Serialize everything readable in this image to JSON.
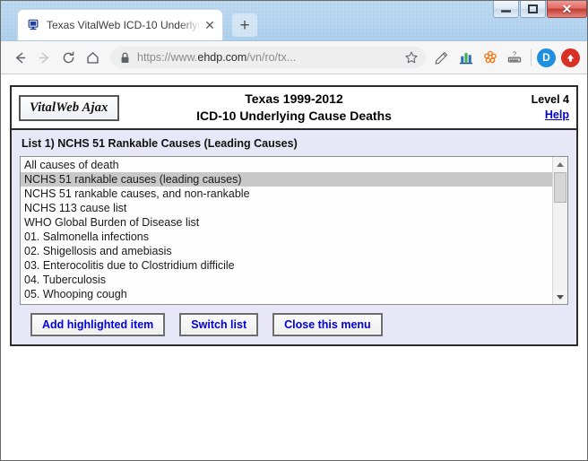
{
  "browser": {
    "tab": {
      "title": "Texas VitalWeb ICD-10 Underlyin",
      "favicon": "computer-monitor-icon",
      "close_label": "✕"
    },
    "new_tab_label": "+",
    "window_controls": {
      "minimize": "minimize-icon",
      "maximize": "maximize-icon",
      "close": "✕"
    },
    "nav": {
      "back": "back-arrow-icon",
      "forward": "forward-arrow-icon",
      "reload": "reload-icon",
      "home": "home-icon"
    },
    "omnibox": {
      "lock": "lock-icon",
      "scheme": "https://www.",
      "host": "ehdp.com",
      "path": "/vn/ro/tx...",
      "bookmark": "star-icon"
    },
    "extensions": [
      {
        "name": "note-pen-icon"
      },
      {
        "name": "bar-chart-icon"
      },
      {
        "name": "molecule-flower-icon"
      },
      {
        "name": "keyboard-help-icon"
      }
    ],
    "profile": {
      "initial": "D",
      "color": "#1f8fe0"
    },
    "update": {
      "name": "update-arrow-icon",
      "color": "#d93025"
    }
  },
  "page": {
    "brand_button": "VitalWeb Ajax",
    "title_line1": "Texas 1999-2012",
    "title_line2": "ICD-10 Underlying Cause Deaths",
    "level": "Level 4",
    "help_link": "Help",
    "list_caption": "List 1) NCHS 51 Rankable Causes (Leading Causes)",
    "list_items": [
      {
        "label": "All causes of death",
        "selected": false
      },
      {
        "label": "NCHS 51 rankable causes (leading causes)",
        "selected": true
      },
      {
        "label": "NCHS 51 rankable causes, and non-rankable",
        "selected": false
      },
      {
        "label": "NCHS 113 cause list",
        "selected": false
      },
      {
        "label": "WHO Global Burden of Disease list",
        "selected": false
      },
      {
        "label": "01. Salmonella infections",
        "selected": false
      },
      {
        "label": "02. Shigellosis and amebiasis",
        "selected": false
      },
      {
        "label": "03. Enterocolitis due to Clostridium difficile",
        "selected": false
      },
      {
        "label": "04. Tuberculosis",
        "selected": false
      },
      {
        "label": "05. Whooping cough",
        "selected": false
      }
    ],
    "buttons": [
      {
        "label": "Add highlighted item"
      },
      {
        "label": "Switch list"
      },
      {
        "label": "Close this menu"
      }
    ],
    "colors": {
      "panel_background": "#e7e7f8",
      "selection": "#c8c8c8",
      "link": "#0000cc",
      "button_text": "#0000dd",
      "border": "#2b2b2b"
    }
  }
}
